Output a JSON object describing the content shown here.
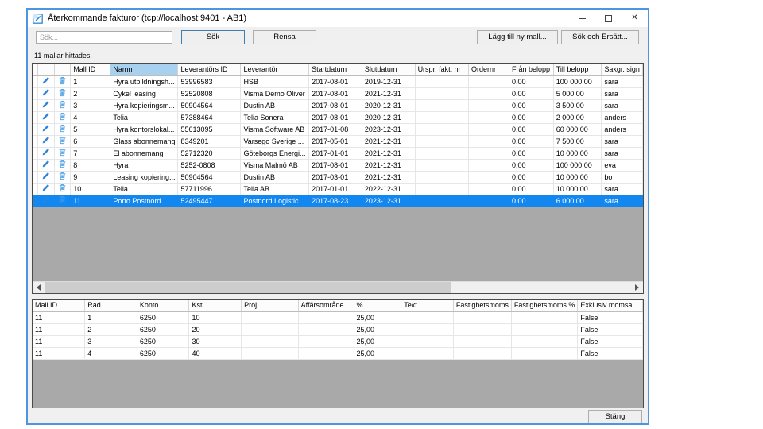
{
  "window": {
    "title": "Återkommande fakturor (tcp://localhost:9401 - AB1)",
    "controls": {
      "minimize": "minimize",
      "maximize": "maximize",
      "close_glyph": "✕"
    }
  },
  "toolbar": {
    "search_placeholder": "Sök...",
    "search_value": "",
    "sok_button": "Sök",
    "rensa_button": "Rensa",
    "add_template_button": "Lägg till ny mall...",
    "search_replace_button": "Sök och Ersätt..."
  },
  "results_count": "11 mallar hittades.",
  "icons": {
    "row_edit": "pencil-icon",
    "row_delete": "trash-icon",
    "titlebar": "app-icon"
  },
  "templates_table": {
    "sorted_column": "Namn",
    "selected_row_index": 10,
    "columns": [
      "Mall ID",
      "Namn",
      "Leverantörs ID",
      "Leverantör",
      "Startdatum",
      "Slutdatum",
      "Urspr. fakt. nr",
      "Ordernr",
      "Från belopp",
      "Till belopp",
      "Sakgr. sign"
    ],
    "rows": [
      [
        "1",
        "Hyra utbildningsh...",
        "53996583",
        "HSB",
        "2017-08-01",
        "2019-12-31",
        "",
        "",
        "0,00",
        "100 000,00",
        "sara"
      ],
      [
        "2",
        "Cykel leasing",
        "52520808",
        "Visma Demo Oliver",
        "2017-08-01",
        "2021-12-31",
        "",
        "",
        "0,00",
        "5 000,00",
        "sara"
      ],
      [
        "3",
        "Hyra kopieringsm...",
        "50904564",
        "Dustin AB",
        "2017-08-01",
        "2020-12-31",
        "",
        "",
        "0,00",
        "3 500,00",
        "sara"
      ],
      [
        "4",
        "Telia",
        "57388464",
        "Telia Sonera",
        "2017-08-01",
        "2020-12-31",
        "",
        "",
        "0,00",
        "2 000,00",
        "anders"
      ],
      [
        "5",
        "Hyra kontorslokal...",
        "55613095",
        "Visma Software AB",
        "2017-01-08",
        "2023-12-31",
        "",
        "",
        "0,00",
        "60 000,00",
        "anders"
      ],
      [
        "6",
        "Glass abonnemang",
        "8349201",
        "Varsego Sverige ...",
        "2017-05-01",
        "2021-12-31",
        "",
        "",
        "0,00",
        "7 500,00",
        "sara"
      ],
      [
        "7",
        "El abonnemang",
        "52712320",
        "Göteborgs Energi...",
        "2017-01-01",
        "2021-12-31",
        "",
        "",
        "0,00",
        "10 000,00",
        "sara"
      ],
      [
        "8",
        "Hyra",
        "5252-0808",
        "Visma Malmö AB",
        "2017-08-01",
        "2021-12-31",
        "",
        "",
        "0,00",
        "100 000,00",
        "eva"
      ],
      [
        "9",
        "Leasing kopiering...",
        "50904564",
        "Dustin AB",
        "2017-03-01",
        "2021-12-31",
        "",
        "",
        "0,00",
        "10 000,00",
        "bo"
      ],
      [
        "10",
        "Telia",
        "57711996",
        "Telia AB",
        "2017-01-01",
        "2022-12-31",
        "",
        "",
        "0,00",
        "10 000,00",
        "sara"
      ],
      [
        "11",
        "Porto Postnord",
        "52495447",
        "Postnord Logistic...",
        "2017-08-23",
        "2023-12-31",
        "",
        "",
        "0,00",
        "6 000,00",
        "sara"
      ]
    ]
  },
  "rows_table": {
    "columns": [
      "Mall ID",
      "Rad",
      "Konto",
      "Kst",
      "Proj",
      "Affärsområde",
      "%",
      "Text",
      "Fastighetsmoms",
      "Fastighetsmoms %",
      "Exklusiv momsal..."
    ],
    "rows": [
      [
        "11",
        "1",
        "6250",
        "10",
        "",
        "",
        "25,00",
        "",
        "",
        "",
        "False"
      ],
      [
        "11",
        "2",
        "6250",
        "20",
        "",
        "",
        "25,00",
        "",
        "",
        "",
        "False"
      ],
      [
        "11",
        "3",
        "6250",
        "30",
        "",
        "",
        "25,00",
        "",
        "",
        "",
        "False"
      ],
      [
        "11",
        "4",
        "6250",
        "40",
        "",
        "",
        "25,00",
        "",
        "",
        "",
        "False"
      ]
    ]
  },
  "footer": {
    "close_button": "Stäng"
  },
  "colors": {
    "window_border": "#4f94e0",
    "selection": "#1287f0",
    "sorted_header": "#a8d1f0",
    "grid_filler": "#a9a9a9",
    "icon_blue": "#2f86d8",
    "trash_blue": "#5aa7e8"
  }
}
